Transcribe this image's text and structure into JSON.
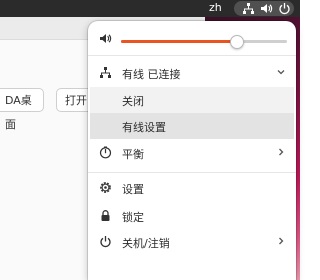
{
  "topbar": {
    "language": "zh",
    "icons": [
      "network-wired-icon",
      "volume-icon",
      "power-icon"
    ]
  },
  "background_app": {
    "buttons": [
      "DA桌面",
      "打开"
    ]
  },
  "menu": {
    "volume": {
      "icon": "volume-icon",
      "level": 0.69,
      "accent": "#e95420"
    },
    "network": {
      "icon": "network-wired-icon",
      "label": "有线 已连接",
      "expanded": true,
      "submenu": [
        {
          "label": "关闭",
          "highlighted": false
        },
        {
          "label": "有线设置",
          "highlighted": true
        }
      ]
    },
    "power_mode": {
      "icon": "power-profile-icon",
      "label": "平衡"
    },
    "settings": {
      "icon": "gear-icon",
      "label": "设置"
    },
    "lock": {
      "icon": "lock-icon",
      "label": "锁定"
    },
    "power_off": {
      "icon": "power-icon",
      "label": "关机/注销"
    }
  }
}
